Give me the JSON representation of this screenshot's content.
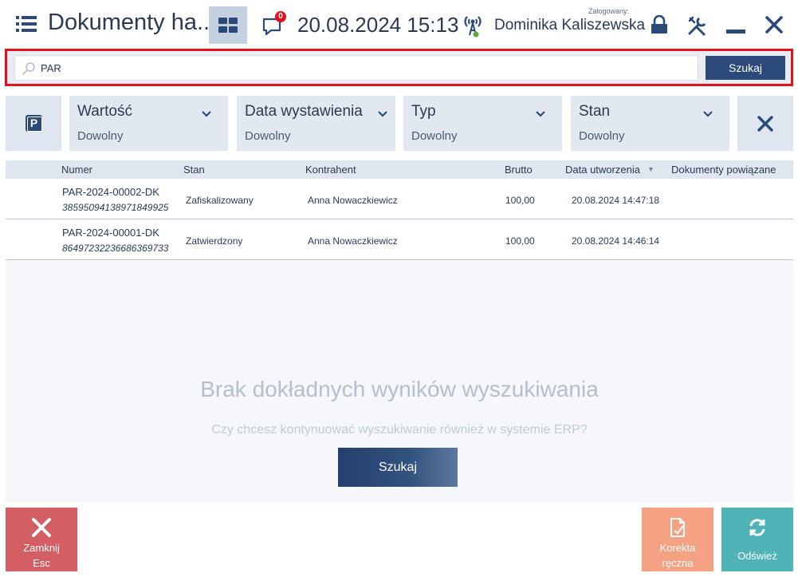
{
  "header": {
    "menu_icon": "hamburger-menu-icon",
    "title": "Dokumenty ha...",
    "tiles_icon": "tiles-grid-icon",
    "messages_icon": "speech-bubble-icon",
    "messages_count": "0",
    "datetime": "20.08.2024 15:13",
    "signal_icon": "antenna-signal-icon",
    "logged_label": "Zalogowany:",
    "user_name": "Dominika Kaliszewska",
    "lock_icon": "lock-icon",
    "tools_icon": "tools-icon",
    "minimize_icon": "minimize-icon",
    "close_icon": "close-icon"
  },
  "search": {
    "value": "PAR",
    "button_label": "Szukaj"
  },
  "filters": [
    {
      "label": "Wartość",
      "value": "Dowolny"
    },
    {
      "label": "Data wystawienia",
      "value": "Dowolny"
    },
    {
      "label": "Typ",
      "value": "Dowolny"
    },
    {
      "label": "Stan",
      "value": "Dowolny"
    }
  ],
  "filter_park_letter": "P",
  "table": {
    "columns": [
      "Numer",
      "Stan",
      "Kontrahent",
      "Brutto",
      "Data utworzenia",
      "Dokumenty powiązane"
    ],
    "sort_indicator": "▼",
    "rows": [
      {
        "number": "PAR-2024-00002-DK",
        "code": "38595094138971849925",
        "status": "Zafiskalizowany",
        "contractor": "Anna Nowaczkiewicz",
        "gross": "100,00",
        "created": "20.08.2024 14:47:18",
        "related": ""
      },
      {
        "number": "PAR-2024-00001-DK",
        "code": "86497232236686369733",
        "status": "Zatwierdzony",
        "contractor": "Anna Nowaczkiewicz",
        "gross": "100,00",
        "created": "20.08.2024 14:46:14",
        "related": ""
      }
    ]
  },
  "empty": {
    "title": "Brak dokładnych wyników wyszukiwania",
    "subtitle": "Czy chcesz kontynuować wyszukiwanie również w systemie ERP?",
    "button_label": "Szukaj"
  },
  "bottom": {
    "close_line1": "Zamknij",
    "close_line2": "Esc",
    "correction_line1": "Korekta",
    "correction_line2": "ręczna",
    "refresh_label": "Odśwież"
  },
  "colors": {
    "accent": "#2b4a7a",
    "highlight_border": "#e4111d",
    "close_button": "#d35e63",
    "correction_button": "#f4a184",
    "refresh_button": "#4fb3b8"
  }
}
